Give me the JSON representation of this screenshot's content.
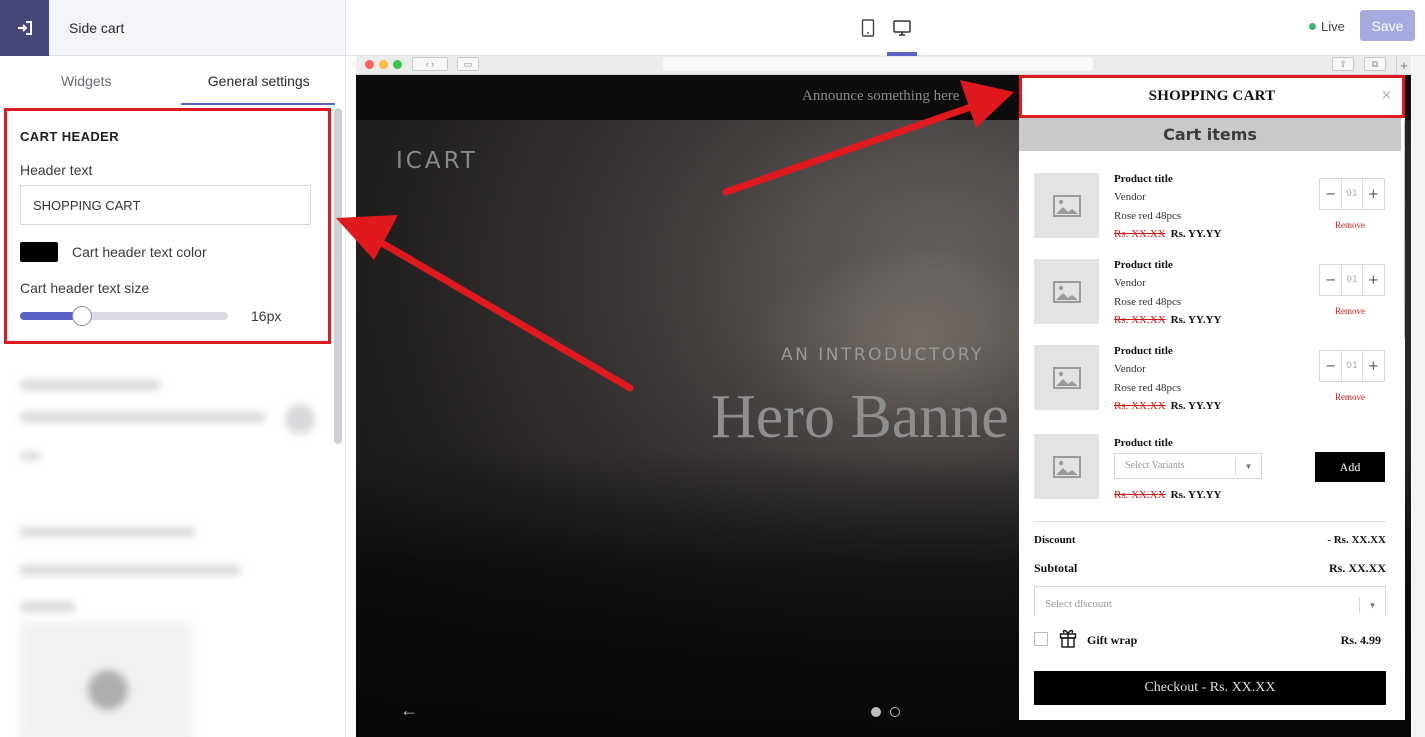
{
  "editor": {
    "panel_title": "Side cart",
    "tabs": [
      {
        "label": "Widgets",
        "active": false
      },
      {
        "label": "General settings",
        "active": true
      }
    ],
    "cart_header_section": {
      "heading": "CART HEADER",
      "header_text_label": "Header text",
      "header_text_value": "SHOPPING CART",
      "text_color_label": "Cart header text color",
      "text_color": "#000000",
      "text_size_label": "Cart header text size",
      "text_size_value": "16px",
      "text_size_fraction": 0.3
    }
  },
  "topbar": {
    "status": "Live",
    "save_label": "Save",
    "active_device": "desktop"
  },
  "preview": {
    "announcement": "Announce something here",
    "logo": "ICART",
    "hero_subtitle": "AN INTRODUCTORY",
    "hero_title": "Hero Banne",
    "hero_prev": "←",
    "slide_count": 2,
    "active_slide": 1
  },
  "cart": {
    "header_title": "SHOPPING CART",
    "close": "×",
    "items_heading": "Cart items",
    "items": [
      {
        "title": "Product title",
        "vendor": "Vendor",
        "variant": "Rose red 48pcs",
        "compare_price": "Rs. XX.XX",
        "price": "Rs. YY.YY",
        "qty_minus": "−",
        "qty": "01",
        "qty_plus": "+",
        "remove": "Remove"
      },
      {
        "title": "Product title",
        "vendor": "Vendor",
        "variant": "Rose red 48pcs",
        "compare_price": "Rs. XX.XX",
        "price": "Rs. YY.YY",
        "qty_minus": "−",
        "qty": "01",
        "qty_plus": "+",
        "remove": "Remove"
      },
      {
        "title": "Product title",
        "vendor": "Vendor",
        "variant": "Rose red 48pcs",
        "compare_price": "Rs. XX.XX",
        "price": "Rs. YY.YY",
        "qty_minus": "−",
        "qty": "01",
        "qty_plus": "+",
        "remove": "Remove"
      }
    ],
    "upsell": {
      "title": "Product title",
      "variant_placeholder": "Select Variants",
      "compare_price": "Rs. XX.XX",
      "price": "Rs. YY.YY",
      "add_label": "Add"
    },
    "discount_label": "Discount",
    "discount_value": "- Rs. XX.XX",
    "subtotal_label": "Subtotal",
    "subtotal_value": "Rs. XX.XX",
    "discount_select_placeholder": "Select discount",
    "gift_wrap_label": "Gift wrap",
    "gift_wrap_price": "Rs. 4.99",
    "checkout_label": "Checkout - Rs. XX.XX"
  },
  "colors": {
    "accent": "#5b62c6",
    "annotation": "#e0191f",
    "back_button": "#47477a",
    "save_disabled": "#a6aadf",
    "live_dot": "#3cb371"
  },
  "icons": {
    "back": "exit-icon",
    "mobile": "mobile-device-icon",
    "desktop": "desktop-device-icon",
    "placeholder": "image-placeholder-icon",
    "gift": "gift-icon"
  }
}
